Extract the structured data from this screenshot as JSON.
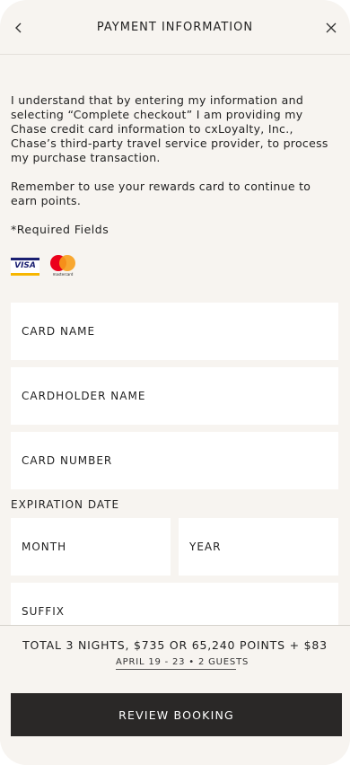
{
  "header": {
    "title": "PAYMENT INFORMATION",
    "back_icon": "chevron-left-icon",
    "close_icon": "close-icon"
  },
  "notice": {
    "paragraph1": "I understand that by entering my information and selecting “Complete checkout” I am providing my Chase credit card information to cxLoyalty, Inc., Chase’s third-party travel service provider, to process my purchase transaction.",
    "paragraph2": "Remember to use your rewards card to continue to earn points.",
    "required": "*Required Fields"
  },
  "card_logos": {
    "visa": "VISA",
    "mastercard": "mastercard"
  },
  "form": {
    "card_name": "CARD NAME",
    "cardholder_name": "CARDHOLDER NAME",
    "card_number": "CARD NUMBER",
    "expiration_label": "EXPIRATION DATE",
    "month": "MONTH",
    "year": "YEAR",
    "suffix": "SUFFIX"
  },
  "footer": {
    "total": "TOTAL 3 NIGHTS, $735 OR 65,240 POINTS + $83",
    "details": "APRIL 19 - 23  •  2 GUESTS",
    "button": "REVIEW BOOKING"
  },
  "colors": {
    "background": "#f7f4f0",
    "button": "#2a2827",
    "visa_blue": "#1a1f71",
    "visa_gold": "#f7b600",
    "mc_red": "#eb001b",
    "mc_orange": "#f79e1b"
  }
}
